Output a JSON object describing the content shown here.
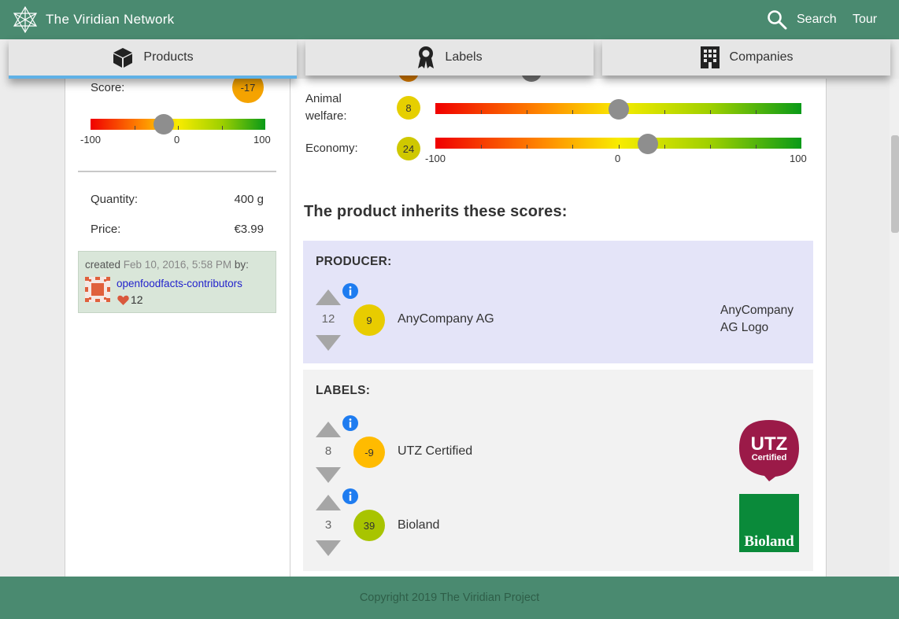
{
  "header": {
    "brand": "The Viridian Network",
    "search_label": "Search",
    "tour_label": "Tour"
  },
  "tabs": [
    {
      "label": "Products",
      "icon": "cube-icon",
      "active": true
    },
    {
      "label": "Labels",
      "icon": "award-ribbon-icon",
      "active": false
    },
    {
      "label": "Companies",
      "icon": "building-icon",
      "active": false
    }
  ],
  "summary": {
    "score_label": "Score:",
    "score_value": "-17",
    "scale_min": "-100",
    "scale_mid": "0",
    "scale_max": "100",
    "quantity_label": "Quantity:",
    "quantity_value": "400 g",
    "price_label": "Price:",
    "price_value": "€3.99"
  },
  "created": {
    "prefix": "created",
    "date": "Feb 10, 2016, 5:58 PM",
    "suffix": "by:",
    "contributor": "openfoodfacts-contributors",
    "likes": "12"
  },
  "subscores": [
    {
      "label_line1": "Animal",
      "label_line2": "welfare:",
      "value": "8",
      "level": 8,
      "color": "#e6cf00"
    },
    {
      "label_line1": "Economy:",
      "label_line2": "",
      "value": "24",
      "level": 24,
      "color": "#cfc800"
    }
  ],
  "subscale": {
    "min": "-100",
    "mid": "0",
    "max": "100"
  },
  "inherit_title": "The product inherits these scores:",
  "producer": {
    "title": "PRODUCER:",
    "votes": "12",
    "score": "9",
    "score_color": "#e8cc00",
    "name": "AnyCompany AG",
    "logo_line1": "AnyCompany",
    "logo_line2": "AG Logo"
  },
  "labels": {
    "title": "LABELS:",
    "items": [
      {
        "votes": "8",
        "score": "-9",
        "score_color": "#ffbb00",
        "name": "UTZ Certified",
        "logo_text_1": "UTZ",
        "logo_text_2": "Certified"
      },
      {
        "votes": "3",
        "score": "39",
        "score_color": "#a8c400",
        "name": "Bioland",
        "logo_text_1": "Bioland"
      }
    ]
  },
  "footer": {
    "copyright": "Copyright 2019 The Viridian Project"
  },
  "colors": {
    "header": "#4a8a70",
    "tab_active_underline": "#5fb1e6",
    "score_main": "#f5a300",
    "producer_card": "#e4e4f8",
    "info_blue": "#1e7cf0",
    "utz_red": "#9b1a48",
    "bioland_green": "#0a8a3a"
  }
}
